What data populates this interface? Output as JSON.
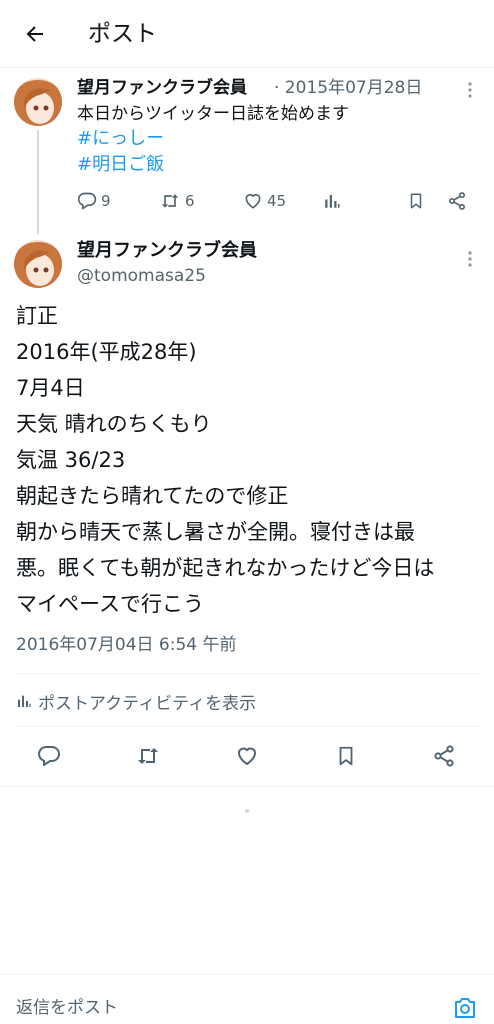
{
  "header": {
    "title": "ポスト"
  },
  "parent_post": {
    "display_name": "望月ファンクラブ会員",
    "date_sep": "· 2015年07月28日",
    "text": "本日からツイッター日誌を始めます",
    "hashtags": [
      "#にっしー",
      "#明日ご飯"
    ],
    "stats": {
      "replies": "9",
      "reposts": "6",
      "likes": "45"
    }
  },
  "main_post": {
    "display_name": "望月ファンクラブ会員",
    "handle": "@tomomasa25",
    "lines": [
      "訂正",
      "2016年(平成28年)",
      "7月4日",
      "天気 晴れのちくもり",
      "気温 36/23",
      "朝起きたら晴れてたので修正",
      "朝から晴天で蒸し暑さが全開。寝付きは最",
      "悪。眠くても朝が起きれなかったけど今日は",
      "マイペースで行こう"
    ],
    "timestamp": "2016年07月04日 6:54 午前",
    "activity_label": "ポストアクティビティを表示"
  },
  "reply_bar": {
    "placeholder": "返信をポスト"
  },
  "colors": {
    "accent": "#1d9bf0",
    "muted": "#536471",
    "text": "#0f1419",
    "divider": "#eff3f4"
  },
  "icons": [
    "back-arrow-icon",
    "more-icon",
    "reply-icon",
    "repost-icon",
    "like-icon",
    "analytics-icon",
    "bookmark-icon",
    "share-icon",
    "camera-icon"
  ]
}
